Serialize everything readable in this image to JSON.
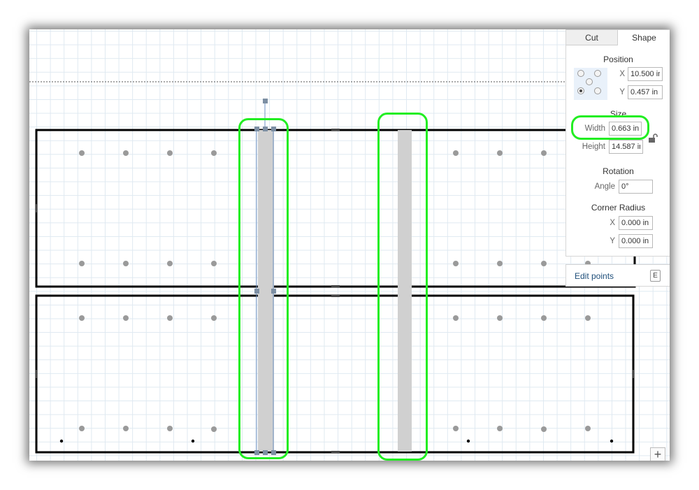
{
  "panel": {
    "tabs": [
      {
        "label": "Cut",
        "active": false
      },
      {
        "label": "Shape",
        "active": true
      }
    ],
    "position": {
      "title": "Position",
      "x_label": "X",
      "x_value": "10.500 in",
      "y_label": "Y",
      "y_value": "0.457 in",
      "anchor_selected": "bottom-left"
    },
    "size": {
      "title": "Size",
      "width_label": "Width",
      "width_value": "0.663 in",
      "height_label": "Height",
      "height_value": "14.587 in",
      "lock_icon": "lock-icon"
    },
    "rotation": {
      "title": "Rotation",
      "angle_label": "Angle",
      "angle_value": "0°"
    },
    "corner_radius": {
      "title": "Corner Radius",
      "x_label": "X",
      "x_value": "0.000 in",
      "y_label": "Y",
      "y_value": "0.000 in"
    }
  },
  "edit_points": {
    "label": "Edit points",
    "shortcut": "E"
  },
  "zoom_button": {
    "icon": "plus-icon",
    "glyph": "+"
  },
  "colors": {
    "highlight": "#22ee22",
    "selection": "#6f93c4",
    "shape_fill": "#d0d0d0",
    "outline": "#000000"
  }
}
